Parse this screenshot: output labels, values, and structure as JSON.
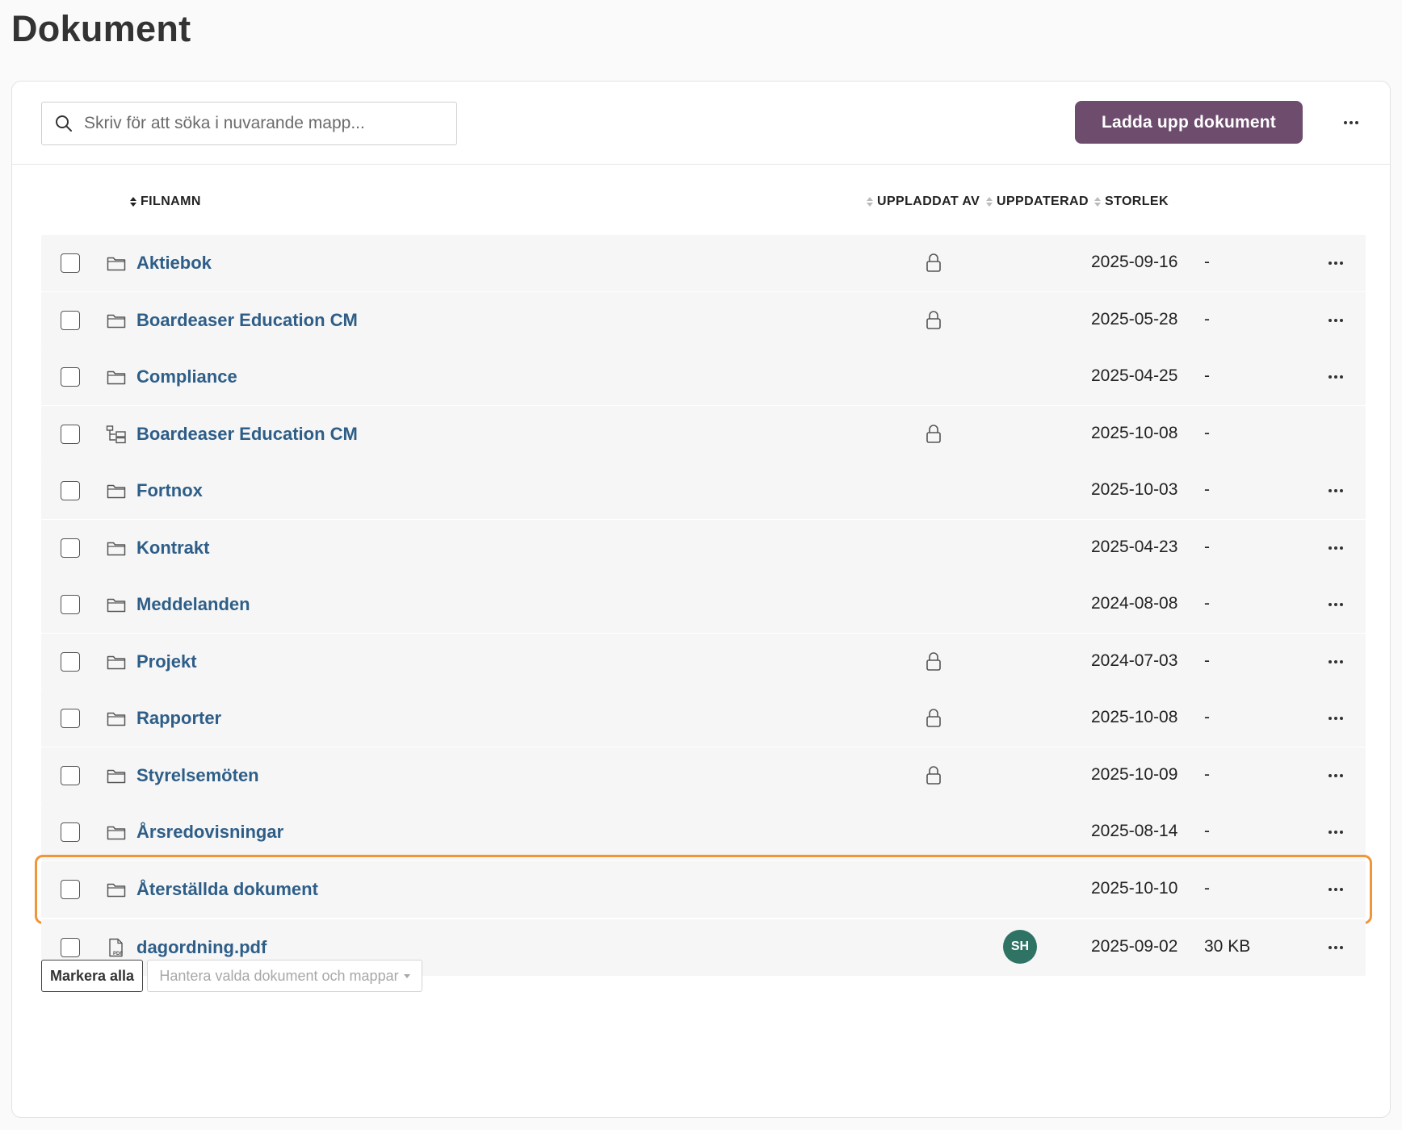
{
  "page": {
    "title": "Dokument"
  },
  "toolbar": {
    "search_placeholder": "Skriv för att söka i nuvarande mapp...",
    "search_value": "",
    "upload_label": "Ladda upp dokument",
    "accent_color": "#6e4c6e"
  },
  "columns": {
    "filename": "FILNAMN",
    "uploaded_by": "UPPLADDAT AV",
    "updated": "UPPDATERAD",
    "size": "STORLEK"
  },
  "rows": [
    {
      "icon": "folder-icon",
      "name": "Aktiebok",
      "locked": true,
      "uploader": "",
      "date": "2025-09-16",
      "size": "-",
      "menu": true
    },
    {
      "icon": "folder-icon",
      "name": "Boardeaser Education CM",
      "locked": true,
      "uploader": "",
      "date": "2025-05-28",
      "size": "-",
      "menu": true
    },
    {
      "icon": "folder-icon",
      "name": "Compliance",
      "locked": false,
      "uploader": "",
      "date": "2025-04-25",
      "size": "-",
      "menu": true
    },
    {
      "icon": "shared-folder-icon",
      "name": "Boardeaser Education CM",
      "locked": true,
      "uploader": "",
      "date": "2025-10-08",
      "size": "-",
      "menu": false
    },
    {
      "icon": "folder-icon",
      "name": "Fortnox",
      "locked": false,
      "uploader": "",
      "date": "2025-10-03",
      "size": "-",
      "menu": true
    },
    {
      "icon": "folder-icon",
      "name": "Kontrakt",
      "locked": false,
      "uploader": "",
      "date": "2025-04-23",
      "size": "-",
      "menu": true
    },
    {
      "icon": "folder-icon",
      "name": "Meddelanden",
      "locked": false,
      "uploader": "",
      "date": "2024-08-08",
      "size": "-",
      "menu": true
    },
    {
      "icon": "folder-icon",
      "name": "Projekt",
      "locked": true,
      "uploader": "",
      "date": "2024-07-03",
      "size": "-",
      "menu": true
    },
    {
      "icon": "folder-icon",
      "name": "Rapporter",
      "locked": true,
      "uploader": "",
      "date": "2025-10-08",
      "size": "-",
      "menu": true
    },
    {
      "icon": "folder-icon",
      "name": "Styrelsemöten",
      "locked": true,
      "uploader": "",
      "date": "2025-10-09",
      "size": "-",
      "menu": true
    },
    {
      "icon": "folder-icon",
      "name": "Årsredovisningar",
      "locked": false,
      "uploader": "",
      "date": "2025-08-14",
      "size": "-",
      "menu": true
    },
    {
      "icon": "folder-icon",
      "name": "Återställda dokument",
      "locked": false,
      "uploader": "",
      "date": "2025-10-10",
      "size": "-",
      "menu": true,
      "highlighted": true
    },
    {
      "icon": "pdf-file-icon",
      "name": "dagordning.pdf",
      "locked": false,
      "uploader": "SH",
      "date": "2025-09-02",
      "size": "30 KB",
      "menu": true
    }
  ],
  "footer": {
    "select_all_label": "Markera alla",
    "manage_label": "Hantera valda dokument och mappar"
  },
  "colors": {
    "link": "#2e5e88",
    "highlight": "#f0963a",
    "avatar": "#2f7364",
    "row_bg": "#f6f6f6"
  }
}
